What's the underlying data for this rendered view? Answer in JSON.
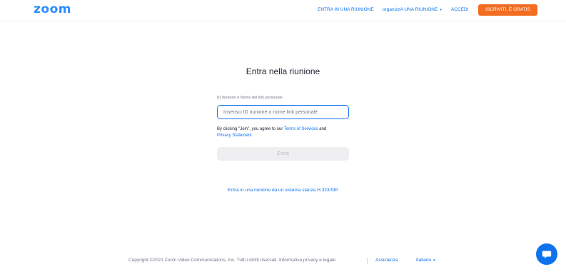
{
  "brand": {
    "logo_text": "zoom",
    "accent": "#0E72ED",
    "logo_color": "#2D8CFF",
    "cta_color": "#F26D21"
  },
  "nav": {
    "join_meeting": "ENTRA IN UNA RIUNIONE",
    "host_prefix": "organizzA",
    "host_rest": " UNA RIUNIONE",
    "sign_in": "ACCEDI",
    "sign_up": "ISCRIVITI, È GRATIS"
  },
  "main": {
    "title": "Entra nella riunione",
    "field_label": "ID riunione o Nome del link personale",
    "input": {
      "placeholder": "Inserisci ID riunione o nome link personale",
      "value": ""
    },
    "agree_text": "By clicking \"Join\", you agree to our",
    "terms_link": "Terms of Services",
    "and_text": "and",
    "privacy_link": "Privacy Statement",
    "join_button": "Entra",
    "h323_link": "Entra in una riunione da un sistema stanza H.323/SIP"
  },
  "footer": {
    "copyright": "Copyright ©2021 Zoom Video Communications, Inc. Tutti i diritti riservati. Informativa privacy e legale",
    "support": "Assistenza",
    "language": "Italiano"
  },
  "icons": {
    "chat": "chat-bubble-icon",
    "caret": "caret-down-icon"
  }
}
